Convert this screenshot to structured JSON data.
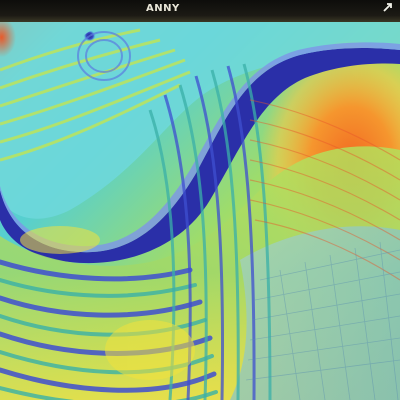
{
  "image": {
    "kind": "abstract-artwork",
    "colors": {
      "deep_blue": "#2a2fa8",
      "royal_blue": "#3e4fd0",
      "cyan": "#4fd6d2",
      "teal": "#3ab0a8",
      "lime": "#b8e24a",
      "yellow": "#f2e23c",
      "orange": "#f08a2a",
      "red_orange": "#e8562a",
      "light_blue": "#9fd8f0"
    }
  },
  "header": {
    "text": "ANNY"
  }
}
